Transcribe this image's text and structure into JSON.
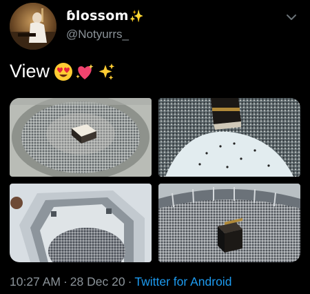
{
  "user": {
    "display_name": "ɓlossom",
    "display_suffix_icon": "sparkles-icon",
    "handle": "@Notyurrs_"
  },
  "tweet": {
    "text": "View",
    "emojis": [
      "heart-eyes-emoji",
      "sparkling-heart-emoji",
      "sparkles-emoji"
    ]
  },
  "media": [
    {
      "name": "kaaba-aerial-crowd"
    },
    {
      "name": "kaaba-courtyard-pilgrims"
    },
    {
      "name": "mosque-aerial-structure"
    },
    {
      "name": "kaaba-mataf-crowd"
    }
  ],
  "meta": {
    "time": "10:27 AM",
    "separator": "·",
    "date": "28 Dec 20",
    "source": "Twitter for Android"
  },
  "colors": {
    "background": "#000000",
    "muted_text": "#8b9399",
    "link": "#1d9bf0"
  }
}
